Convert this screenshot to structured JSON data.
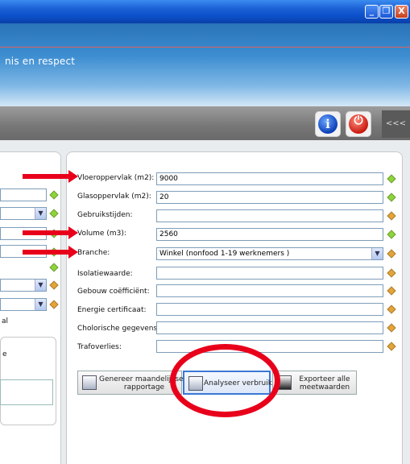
{
  "window": {
    "minimize": "_",
    "maximize": "❐",
    "close": "X"
  },
  "header": {
    "tagline": "nis en respect"
  },
  "toolbar": {
    "info": "i",
    "power": "⏻",
    "collapse": "<<<"
  },
  "left_panel": {
    "text_1": "al",
    "text_2": "e"
  },
  "form": {
    "fields": [
      {
        "label": "Vloeroppervlak (m2):",
        "value": "9000",
        "status": "green"
      },
      {
        "label": "Glasoppervlak (m2):",
        "value": "20",
        "status": "green"
      },
      {
        "label": "Gebruikstijden:",
        "value": "",
        "status": "orange"
      },
      {
        "label": "Volume (m3):",
        "value": "2560",
        "status": "green"
      },
      {
        "label": "Branche:",
        "value": "Winkel (nonfood 1-19 werknemers )",
        "status": "orange",
        "dropdown": "▼"
      },
      {
        "label": "Isolatiewaarde:",
        "value": "",
        "status": "orange"
      },
      {
        "label": "Gebouw coëfficiënt:",
        "value": "",
        "status": "orange"
      },
      {
        "label": "Energie certificaat:",
        "value": "",
        "status": "orange"
      },
      {
        "label": "Cholorische gegevens:",
        "value": "",
        "status": "orange"
      },
      {
        "label": "Trafoverlies:",
        "value": "",
        "status": "orange"
      }
    ]
  },
  "actions": {
    "genereer_line1": "Genereer maandelijkse",
    "genereer_line2": "rapportage",
    "analyseer": "Analyseer verbruik",
    "exporteer_line1": "Exporteer alle",
    "exporteer_line2": "meetwaarden"
  },
  "colors": {
    "accent": "#e8001b",
    "status_green": "#8fd33c",
    "status_orange": "#e3a43a"
  }
}
